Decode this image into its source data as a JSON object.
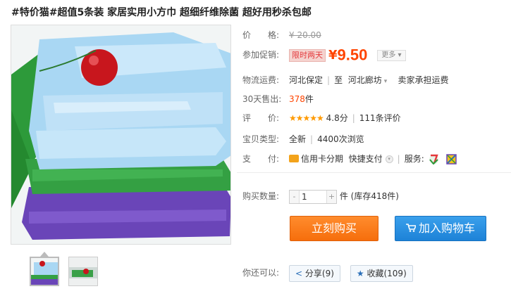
{
  "title": "#特价猫#超值5条装 家居实用小方巾 超细纤维除菌 超好用秒杀包邮",
  "price": {
    "label": "价　　格:",
    "original": "¥ 20.00"
  },
  "promo": {
    "label": "参加促销:",
    "tag": "限时两天",
    "yen": "¥",
    "price": "9.50",
    "more": "更多 ▾"
  },
  "shipping": {
    "label": "物流运费:",
    "from": "河北保定",
    "to_prefix": "至",
    "to": "河北廊坊",
    "fee": "卖家承担运费"
  },
  "sold": {
    "label": "30天售出:",
    "count": "378",
    "unit": "件"
  },
  "rating": {
    "label": "评　　价:",
    "stars": "★★★★★",
    "score": "4.8分",
    "reviews": "111条评价"
  },
  "item_type": {
    "label": "宝贝类型:",
    "condition": "全新",
    "views": "4400次浏览"
  },
  "payment": {
    "label": "支　　付:",
    "installment": "信用卡分期",
    "quick": "快捷支付",
    "service_label": "服务:"
  },
  "quantity": {
    "label": "购买数量:",
    "value": "1",
    "minus": "-",
    "plus": "+",
    "unit": "件",
    "stock": "(库存418件)"
  },
  "buttons": {
    "buy": "立刻购买",
    "cart": "加入购物车"
  },
  "social": {
    "label": "你还可以:",
    "share": "分享(9)",
    "favorite": "收藏(109)"
  },
  "colors": {
    "accent": "#ff4400",
    "buy": "#f67810",
    "cart": "#2288dd"
  }
}
